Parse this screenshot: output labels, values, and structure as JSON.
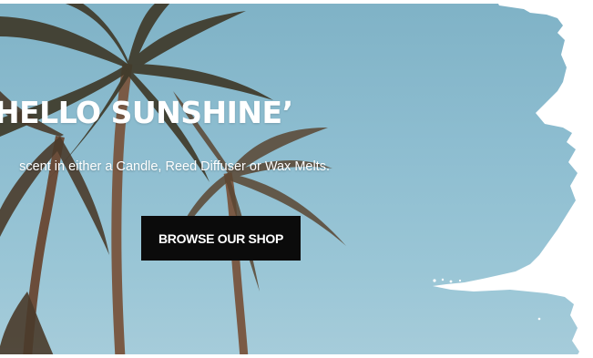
{
  "hero": {
    "headline": "HELLO SUNSHINE’",
    "subtext": "scent in either a Candle, Reed Diffuser or Wax Melts.",
    "cta_label": "BROWSE OUR SHOP"
  },
  "colors": {
    "sky": "#8dbdd0",
    "button_bg": "#0b0b0b",
    "text": "#ffffff",
    "page_bg": "#ffffff"
  }
}
